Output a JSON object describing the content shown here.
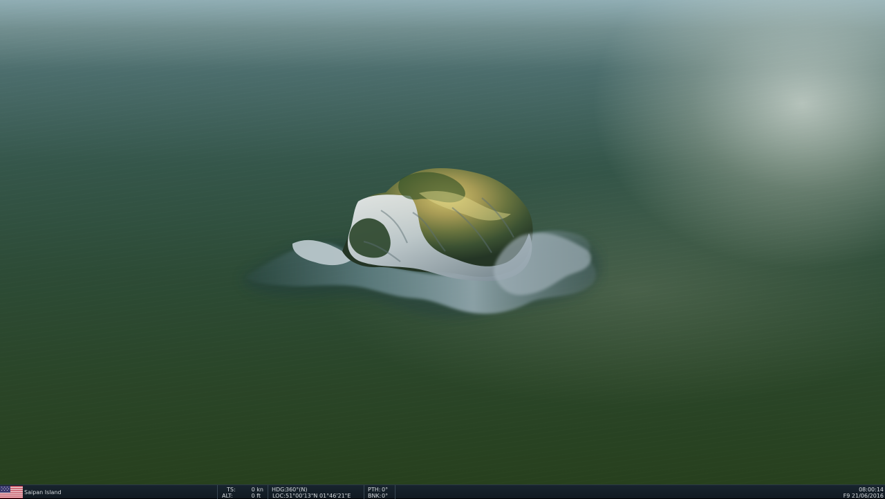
{
  "location": {
    "name": "Saipan Island",
    "flag": "usa-flag-icon"
  },
  "telemetry": {
    "ts_label": "TS:",
    "ts_value": "0 kn",
    "alt_label": "ALT:",
    "alt_value": "0 ft",
    "hdg_label": "HDG:",
    "hdg_value": "360°(N)",
    "loc_label": "LOC:",
    "loc_value": "51°00'13\"N 01°46'21\"E",
    "pth_label": "PTH:",
    "pth_value": "0°",
    "bnk_label": "BNK:",
    "bnk_value": "0°"
  },
  "clock": {
    "time": "08:00:14",
    "date": "F9 21/06/2016"
  },
  "colors": {
    "hud_background": "#121c24",
    "hud_text": "#d9dde0",
    "water_dark": "#2a4528",
    "water_light": "#4f6f6c"
  }
}
